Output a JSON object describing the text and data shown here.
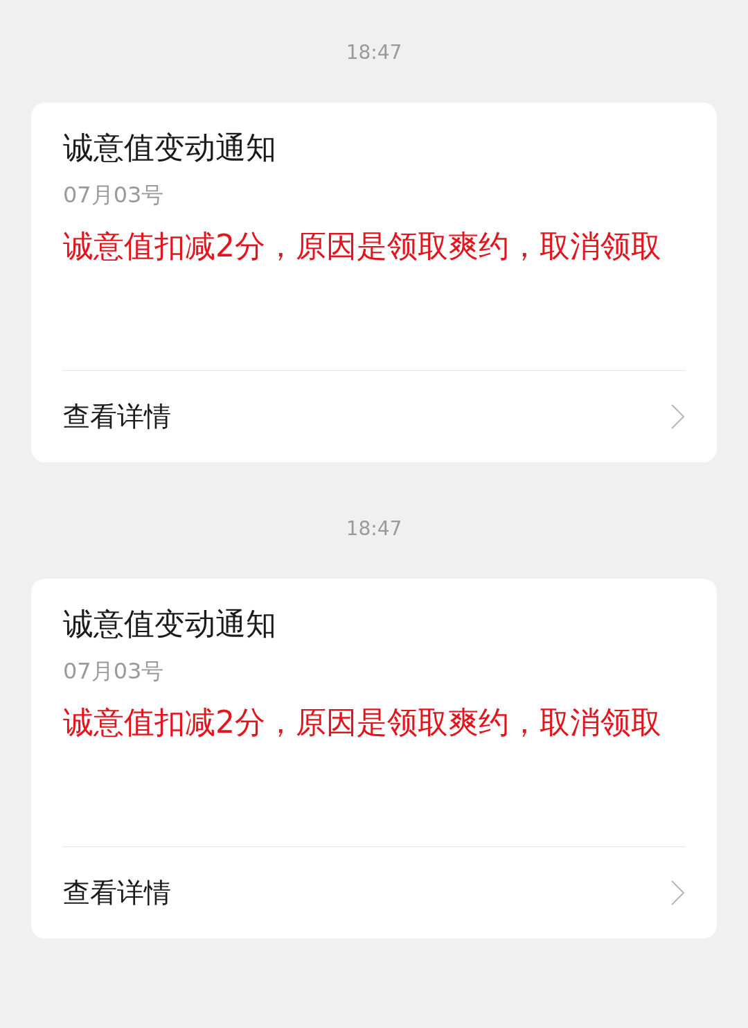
{
  "messages": [
    {
      "time": "18:47",
      "title": "诚意值变动通知",
      "date": "07月03号",
      "body": "诚意值扣减2分，原因是领取爽约，取消领取",
      "link": "查看详情"
    },
    {
      "time": "18:47",
      "title": "诚意值变动通知",
      "date": "07月03号",
      "body": "诚意值扣减2分，原因是领取爽约，取消领取",
      "link": "查看详情"
    }
  ]
}
